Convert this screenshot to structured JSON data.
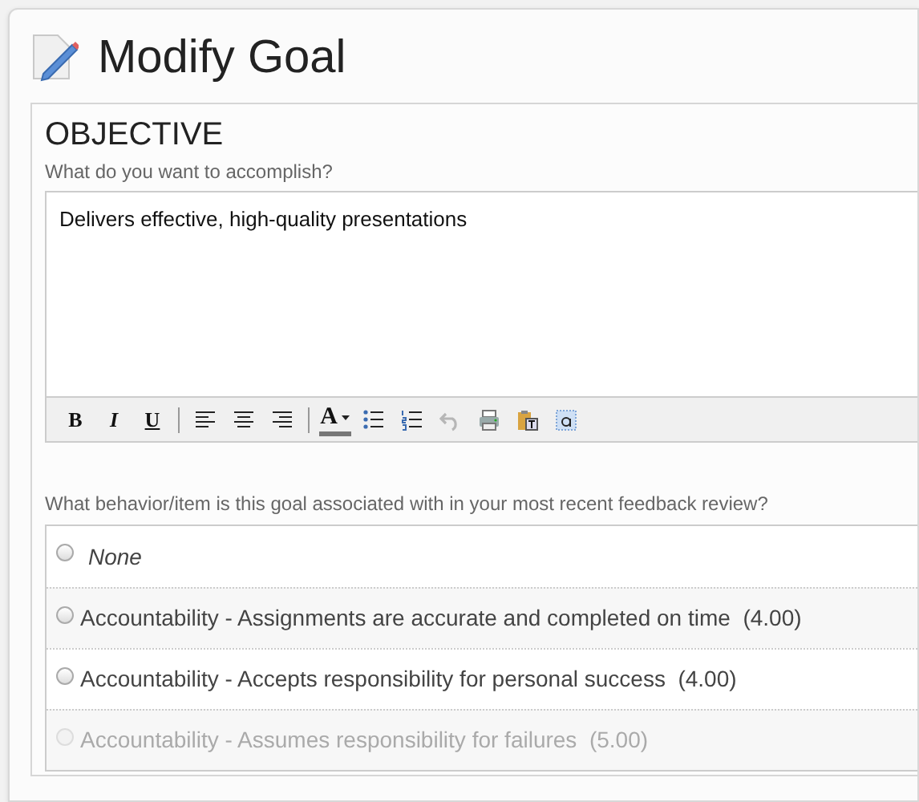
{
  "title": "Modify Goal",
  "objective": {
    "heading": "OBJECTIVE",
    "prompt": "What do you want to accomplish?",
    "value": "Delivers effective, high-quality presentations",
    "toolbar": [
      {
        "kind": "bold",
        "label": "B"
      },
      {
        "kind": "italic",
        "label": "I"
      },
      {
        "kind": "underline",
        "label": "U"
      },
      {
        "kind": "sep"
      },
      {
        "kind": "align-left"
      },
      {
        "kind": "align-center"
      },
      {
        "kind": "align-right"
      },
      {
        "kind": "sep"
      },
      {
        "kind": "font-color",
        "label": "A"
      },
      {
        "kind": "bullets"
      },
      {
        "kind": "numbers"
      },
      {
        "kind": "undo",
        "disabled": true
      },
      {
        "kind": "print"
      },
      {
        "kind": "paste"
      },
      {
        "kind": "select-all"
      }
    ]
  },
  "behavior": {
    "prompt": "What behavior/item is this goal associated with in your most recent feedback review?",
    "options": [
      {
        "label": "None",
        "kind": "none",
        "selected": false,
        "disabled": false
      },
      {
        "label": "Accountability - Assignments are accurate and completed on time  (4.00)",
        "kind": "item",
        "selected": false,
        "disabled": false
      },
      {
        "label": "Accountability - Accepts responsibility for personal success  (4.00)",
        "kind": "item",
        "selected": false,
        "disabled": false
      },
      {
        "label": "Accountability - Assumes responsibility for failures  (5.00)",
        "kind": "item",
        "selected": false,
        "disabled": true
      }
    ]
  }
}
